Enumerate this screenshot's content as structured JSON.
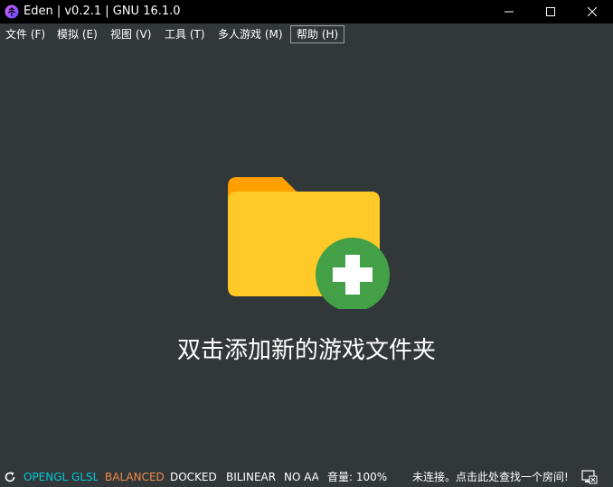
{
  "window": {
    "title": "Eden | v0.2.1 | GNU 16.1.0",
    "icon": "eden-logo-icon"
  },
  "menu": {
    "items": [
      {
        "label": "文件 (F)"
      },
      {
        "label": "模拟 (E)"
      },
      {
        "label": "视图 (V)"
      },
      {
        "label": "工具 (T)"
      },
      {
        "label": "多人游戏 (M)"
      },
      {
        "label": "帮助 (H)"
      }
    ]
  },
  "main": {
    "empty_message": "双击添加新的游戏文件夹",
    "icon": "add-folder-icon"
  },
  "status": {
    "renderer": "OPENGL GLSL",
    "gpu_accuracy": "BALANCED",
    "dock_mode": "DOCKED",
    "filter": "BILINEAR",
    "anti_alias": "NO AA",
    "volume": "音量: 100%",
    "room": "未连接。点击此处查找一个房间!",
    "colors": {
      "renderer": "#00c8d7",
      "gpu_accuracy": "#f08a4b",
      "default": "#ffffff"
    }
  },
  "colors": {
    "background": "#32373a",
    "titlebar": "#000000",
    "folder_back": "#ffa000",
    "folder_front": "#ffca28",
    "plus_circle": "#43a047"
  }
}
